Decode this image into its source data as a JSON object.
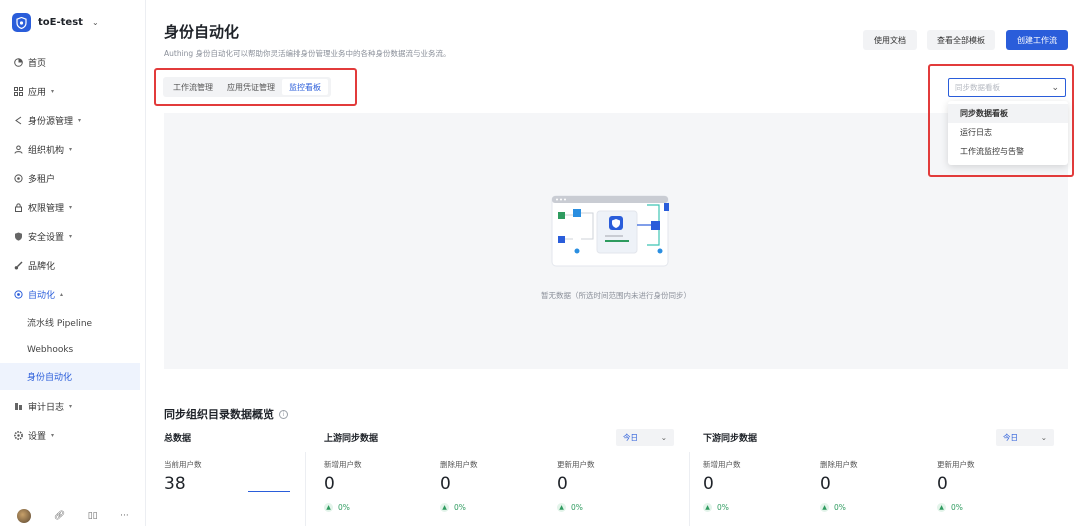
{
  "org": {
    "name": "toE-test"
  },
  "sidebar": {
    "items": [
      {
        "label": "首页",
        "icon": "pie-chart-icon",
        "caret": false
      },
      {
        "label": "应用",
        "icon": "apps-icon",
        "caret": true
      },
      {
        "label": "身份源管理",
        "icon": "share-icon",
        "caret": true
      },
      {
        "label": "组织机构",
        "icon": "users-icon",
        "caret": true
      },
      {
        "label": "多租户",
        "icon": "tenant-icon",
        "caret": false
      },
      {
        "label": "权限管理",
        "icon": "lock-icon",
        "caret": true
      },
      {
        "label": "安全设置",
        "icon": "shield-icon",
        "caret": true
      },
      {
        "label": "品牌化",
        "icon": "brush-icon",
        "caret": false
      },
      {
        "label": "自动化",
        "icon": "automation-icon",
        "caret": true,
        "expanded": true
      }
    ],
    "sub_items": [
      "流水线 Pipeline",
      "Webhooks",
      "身份自动化"
    ],
    "bottom_items": [
      {
        "label": "审计日志",
        "icon": "audit-icon"
      },
      {
        "label": "设置",
        "icon": "gear-icon"
      }
    ]
  },
  "header": {
    "title": "身份自动化",
    "description": "Authing 身份自动化可以帮助你灵活编排身份管理业务中的各种身份数据流与业务流。",
    "buttons": {
      "docs": "使用文档",
      "templates": "查看全部模板",
      "create": "创建工作流"
    }
  },
  "tabs": [
    "工作流管理",
    "应用凭证管理",
    "监控看板"
  ],
  "active_tab": "监控看板",
  "dropdown": {
    "placeholder": "同步数据看板",
    "options": [
      "同步数据看板",
      "运行日志",
      "工作流监控与告警"
    ],
    "selected": "同步数据看板"
  },
  "empty_state": {
    "text": "暂无数据（所选时间范围内未进行身份同步）"
  },
  "overview": {
    "title": "同步组织目录数据概览",
    "total": {
      "title": "总数据",
      "label": "当前用户数",
      "value": "38"
    },
    "upstream": {
      "title": "上游同步数据",
      "range": "今日",
      "metrics": [
        {
          "label": "新增用户数",
          "value": "0",
          "pct": "0%"
        },
        {
          "label": "删除用户数",
          "value": "0",
          "pct": "0%"
        },
        {
          "label": "更新用户数",
          "value": "0",
          "pct": "0%"
        }
      ]
    },
    "downstream": {
      "title": "下游同步数据",
      "range": "今日",
      "metrics": [
        {
          "label": "新增用户数",
          "value": "0",
          "pct": "0%"
        },
        {
          "label": "删除用户数",
          "value": "0",
          "pct": "0%"
        },
        {
          "label": "更新用户数",
          "value": "0",
          "pct": "0%"
        }
      ]
    }
  },
  "colors": {
    "primary": "#2a5dda",
    "highlight_border": "#e23b3b",
    "positive": "#2e9b5f"
  }
}
